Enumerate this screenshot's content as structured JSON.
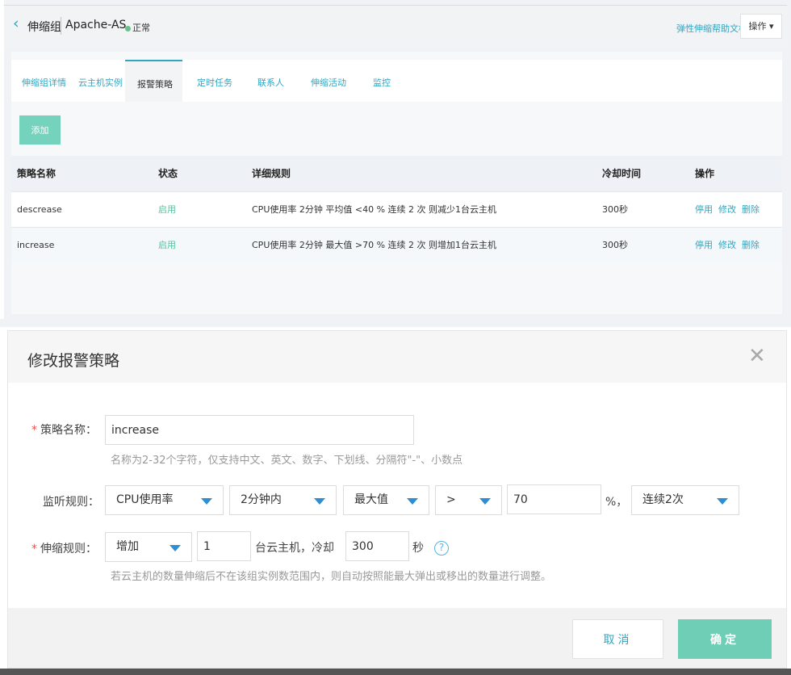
{
  "header": {
    "back_icon": "chevron-left-icon",
    "title": "伸缩组",
    "group_name": "Apache-AS",
    "status": "正常",
    "status_color": "#67c28a",
    "help_link": "弹性伸缩帮助文档",
    "actions_label": "操作 ▾"
  },
  "tabs": [
    {
      "label": "伸缩组详情"
    },
    {
      "label": "云主机实例"
    },
    {
      "label": "报警策略"
    },
    {
      "label": "定时任务"
    },
    {
      "label": "联系人"
    },
    {
      "label": "伸缩活动"
    },
    {
      "label": "监控"
    }
  ],
  "add_button": "添加",
  "table": {
    "headers": [
      "策略名称",
      "状态",
      "详细规则",
      "冷却时间",
      "操作"
    ],
    "rows": [
      {
        "name": "descrease",
        "state": "启用",
        "rule": "CPU使用率 2分钟 平均值 <40 % 连续 2 次 则减少1台云主机",
        "cooldown": "300秒",
        "ops": [
          "停用",
          "修改",
          "删除"
        ]
      },
      {
        "name": "increase",
        "state": "启用",
        "rule": "CPU使用率 2分钟 最大值 >70 % 连续 2 次 则增加1台云主机",
        "cooldown": "300秒",
        "ops": [
          "停用",
          "修改",
          "删除"
        ]
      }
    ]
  },
  "modal": {
    "title": "修改报警策略",
    "close_icon": "close-icon",
    "name_label": "策略名称：",
    "name_value": "increase",
    "name_hint": "名称为2-32个字符，仅支持中文、英文、数字、下划线、分隔符\"-\"、小数点",
    "monitor_label": "监听规则：",
    "metric": "CPU使用率",
    "period": "2分钟内",
    "stat": "最大值",
    "operator": ">",
    "threshold": "70",
    "unit_sep": "%，",
    "times": "连续2次",
    "scale_label": "伸缩规则：",
    "scale_action": "增加",
    "scale_count": "1",
    "scale_text": "台云主机，冷却",
    "cooldown_value": "300",
    "cooldown_unit": "秒",
    "help_icon": "question-circle-icon",
    "scale_hint": "若云主机的数量伸缩后不在该组实例数范围内，则自动按照能最大弹出或移出的数量进行调整。",
    "cancel": "取消",
    "confirm": "确定"
  },
  "colors": {
    "accent": "#2fa6c2",
    "primary_button": "#6fcfb6",
    "enabled_state": "#52c39c",
    "required_star": "#e0554f"
  }
}
